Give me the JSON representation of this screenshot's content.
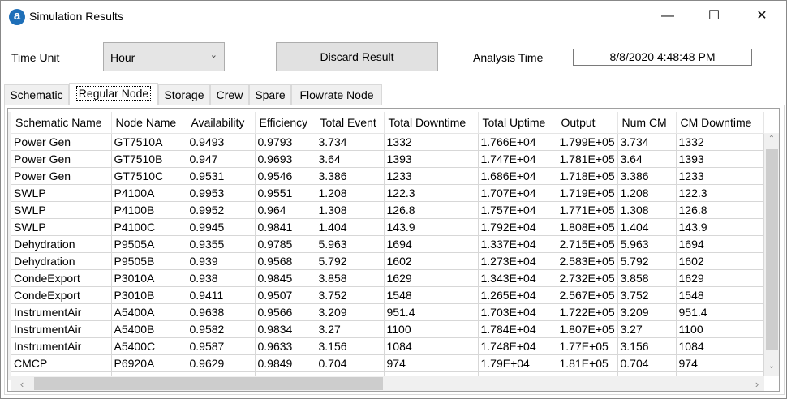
{
  "window": {
    "title": "Simulation Results",
    "minimize": "—",
    "maximize": "☐",
    "close": "✕",
    "app_icon": "a"
  },
  "controls": {
    "time_unit_label": "Time Unit",
    "time_unit_value": "Hour",
    "discard_label": "Discard Result",
    "analysis_time_label": "Analysis Time",
    "analysis_time_value": "8/8/2020 4:48:48 PM"
  },
  "tabs": [
    {
      "label": "Schematic"
    },
    {
      "label": "Regular Node",
      "active": true
    },
    {
      "label": "Storage"
    },
    {
      "label": "Crew"
    },
    {
      "label": "Spare"
    },
    {
      "label": "Flowrate Node"
    }
  ],
  "table": {
    "columns": [
      "Schematic Name",
      "Node Name",
      "Availability",
      "Efficiency",
      "Total Event",
      "Total Downtime",
      "Total Uptime",
      "Output",
      "Num CM",
      "CM Downtime"
    ],
    "rows": [
      [
        "Power Gen",
        "GT7510A",
        "0.9493",
        "0.9793",
        "3.734",
        "1332",
        "1.766E+04",
        "1.799E+05",
        "3.734",
        "1332"
      ],
      [
        "Power Gen",
        "GT7510B",
        "0.947",
        "0.9693",
        "3.64",
        "1393",
        "1.747E+04",
        "1.781E+05",
        "3.64",
        "1393"
      ],
      [
        "Power Gen",
        "GT7510C",
        "0.9531",
        "0.9546",
        "3.386",
        "1233",
        "1.686E+04",
        "1.718E+05",
        "3.386",
        "1233"
      ],
      [
        "SWLP",
        "P4100A",
        "0.9953",
        "0.9551",
        "1.208",
        "122.3",
        "1.707E+04",
        "1.719E+05",
        "1.208",
        "122.3"
      ],
      [
        "SWLP",
        "P4100B",
        "0.9952",
        "0.964",
        "1.308",
        "126.8",
        "1.757E+04",
        "1.771E+05",
        "1.308",
        "126.8"
      ],
      [
        "SWLP",
        "P4100C",
        "0.9945",
        "0.9841",
        "1.404",
        "143.9",
        "1.792E+04",
        "1.808E+05",
        "1.404",
        "143.9"
      ],
      [
        "Dehydration",
        "P9505A",
        "0.9355",
        "0.9785",
        "5.963",
        "1694",
        "1.337E+04",
        "2.715E+05",
        "5.963",
        "1694"
      ],
      [
        "Dehydration",
        "P9505B",
        "0.939",
        "0.9568",
        "5.792",
        "1602",
        "1.273E+04",
        "2.583E+05",
        "5.792",
        "1602"
      ],
      [
        "CondeExport",
        "P3010A",
        "0.938",
        "0.9845",
        "3.858",
        "1629",
        "1.343E+04",
        "2.732E+05",
        "3.858",
        "1629"
      ],
      [
        "CondeExport",
        "P3010B",
        "0.9411",
        "0.9507",
        "3.752",
        "1548",
        "1.265E+04",
        "2.567E+05",
        "3.752",
        "1548"
      ],
      [
        "InstrumentAir",
        "A5400A",
        "0.9638",
        "0.9566",
        "3.209",
        "951.4",
        "1.703E+04",
        "1.722E+05",
        "3.209",
        "951.4"
      ],
      [
        "InstrumentAir",
        "A5400B",
        "0.9582",
        "0.9834",
        "3.27",
        "1100",
        "1.784E+04",
        "1.807E+05",
        "3.27",
        "1100"
      ],
      [
        "InstrumentAir",
        "A5400C",
        "0.9587",
        "0.9633",
        "3.156",
        "1084",
        "1.748E+04",
        "1.77E+05",
        "3.156",
        "1084"
      ],
      [
        "CMCP",
        "P6920A",
        "0.9629",
        "0.9849",
        "0.704",
        "974",
        "1.79E+04",
        "1.81E+05",
        "0.704",
        "974"
      ]
    ]
  }
}
